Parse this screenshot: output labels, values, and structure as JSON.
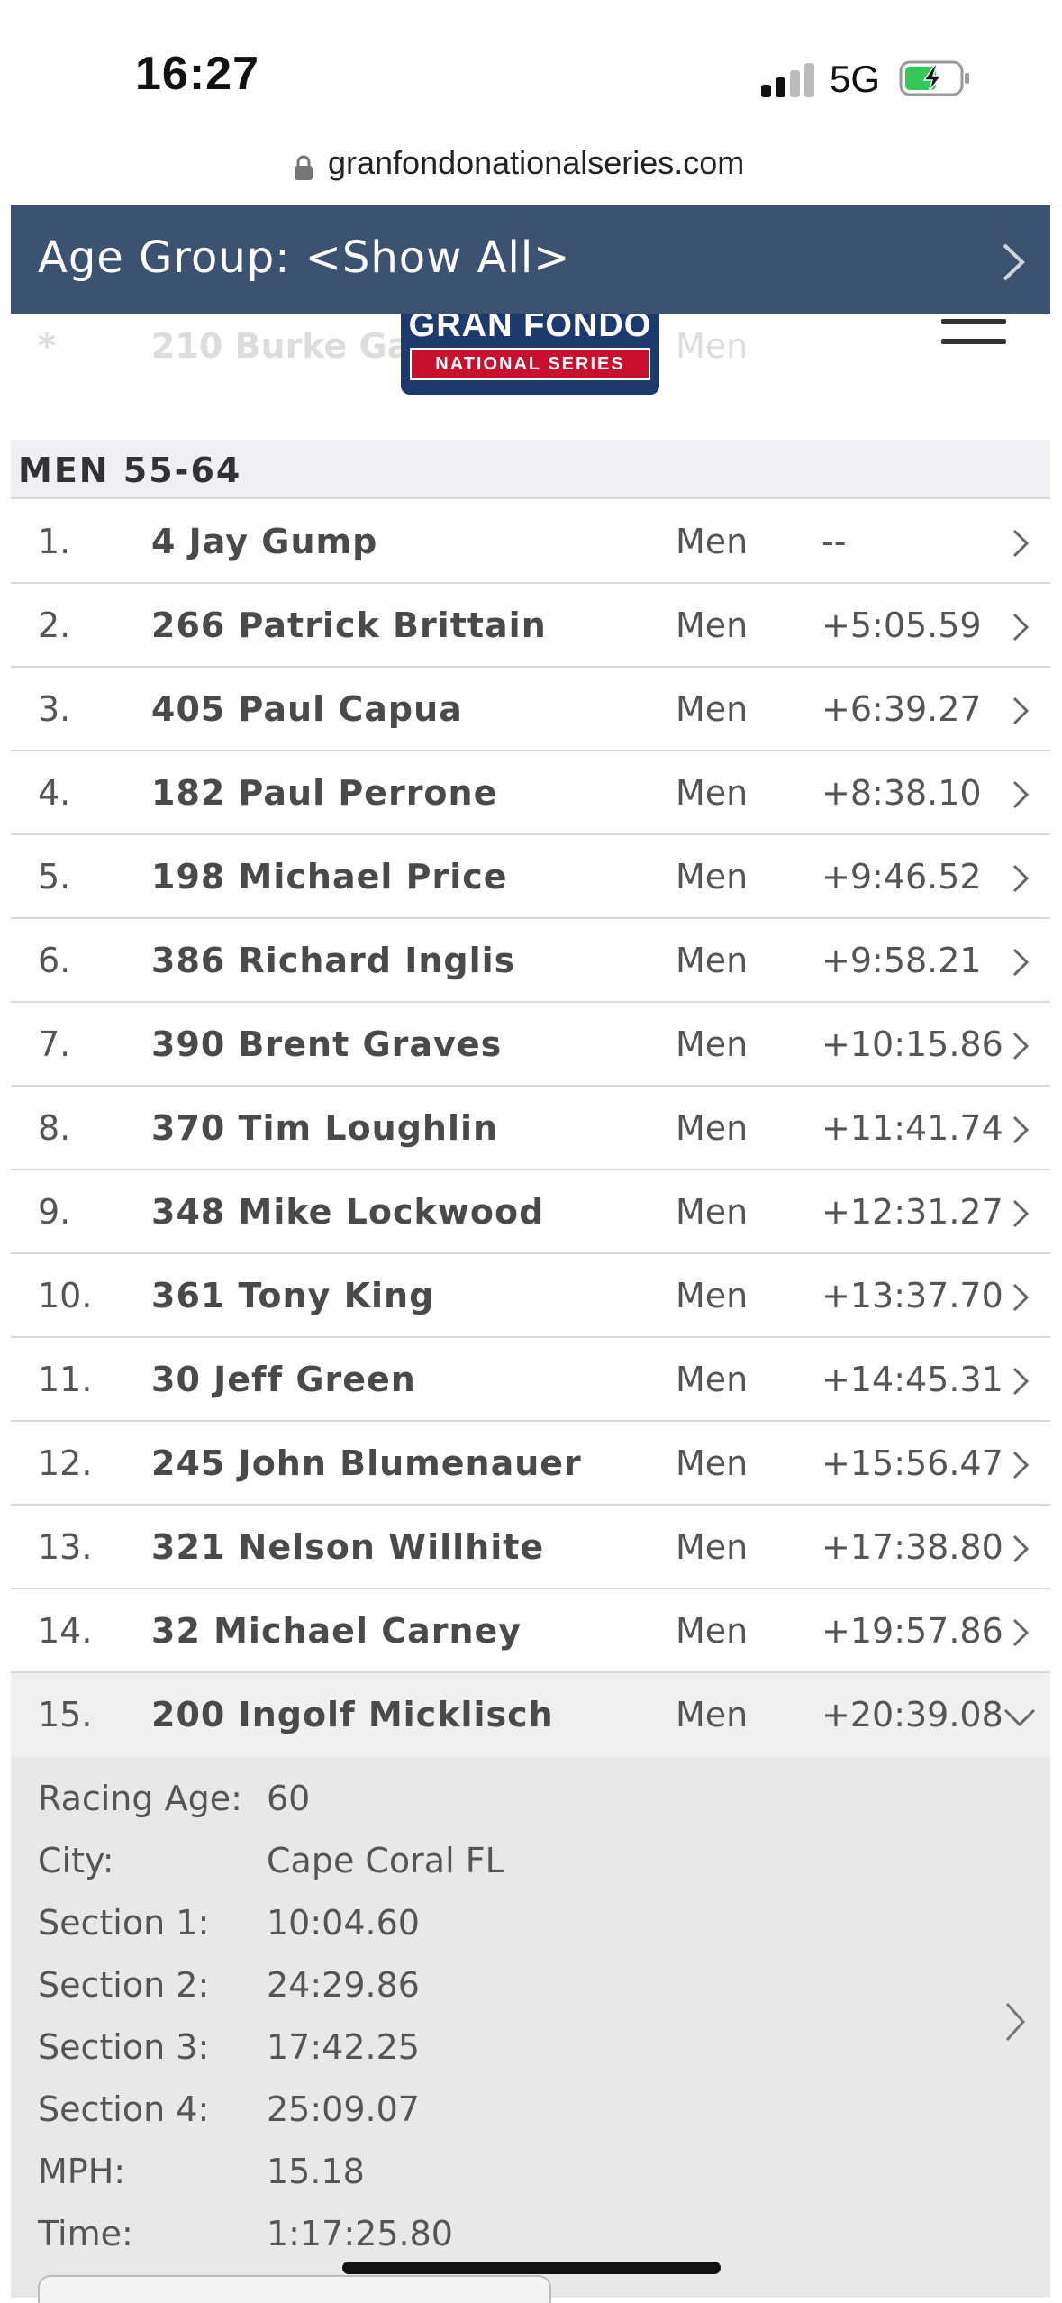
{
  "status_bar": {
    "time": "16:27",
    "network": "5G",
    "signal_icon": "cellular-signal-icon",
    "battery_icon": "battery-charging-icon"
  },
  "browser": {
    "url": "granfondonationalseries.com",
    "lock_icon": "lock-icon"
  },
  "header": {
    "logo_top": "GRAN FONDO",
    "logo_bottom": "NATIONAL SERIES",
    "ghost_row": {
      "position": "*",
      "name": "210 Burke Ga",
      "category": "Men"
    },
    "menu_icon": "hamburger-menu-icon"
  },
  "age_group": {
    "label": "Age Group: <Show All>"
  },
  "section": {
    "title": "MEN 55-64"
  },
  "results": [
    {
      "position": "1.",
      "name": "4 Jay Gump",
      "category": "Men",
      "gap": "--"
    },
    {
      "position": "2.",
      "name": "266 Patrick Brittain",
      "category": "Men",
      "gap": "+5:05.59"
    },
    {
      "position": "3.",
      "name": "405 Paul Capua",
      "category": "Men",
      "gap": "+6:39.27"
    },
    {
      "position": "4.",
      "name": "182 Paul Perrone",
      "category": "Men",
      "gap": "+8:38.10"
    },
    {
      "position": "5.",
      "name": "198 Michael Price",
      "category": "Men",
      "gap": "+9:46.52"
    },
    {
      "position": "6.",
      "name": "386 Richard Inglis",
      "category": "Men",
      "gap": "+9:58.21"
    },
    {
      "position": "7.",
      "name": "390 Brent Graves",
      "category": "Men",
      "gap": "+10:15.86"
    },
    {
      "position": "8.",
      "name": "370 Tim Loughlin",
      "category": "Men",
      "gap": "+11:41.74"
    },
    {
      "position": "9.",
      "name": "348 Mike Lockwood",
      "category": "Men",
      "gap": "+12:31.27"
    },
    {
      "position": "10.",
      "name": "361 Tony King",
      "category": "Men",
      "gap": "+13:37.70"
    },
    {
      "position": "11.",
      "name": "30 Jeff Green",
      "category": "Men",
      "gap": "+14:45.31"
    },
    {
      "position": "12.",
      "name": "245 John Blumenauer",
      "category": "Men",
      "gap": "+15:56.47"
    },
    {
      "position": "13.",
      "name": "321 Nelson Willhite",
      "category": "Men",
      "gap": "+17:38.80"
    },
    {
      "position": "14.",
      "name": "32 Michael Carney",
      "category": "Men",
      "gap": "+19:57.86"
    }
  ],
  "expanded": {
    "position": "15.",
    "name": "200 Ingolf Micklisch",
    "category": "Men",
    "gap": "+20:39.08",
    "details": [
      {
        "label": "Racing Age:",
        "value": "60"
      },
      {
        "label": "City:",
        "value": "Cape Coral FL"
      },
      {
        "label": "Section 1:",
        "value": "10:04.60"
      },
      {
        "label": "Section 2:",
        "value": "24:29.86"
      },
      {
        "label": "Section 3:",
        "value": "17:42.25"
      },
      {
        "label": "Section 4:",
        "value": "25:09.07"
      },
      {
        "label": "MPH:",
        "value": "15.18"
      },
      {
        "label": "Time:",
        "value": "1:17:25.80"
      }
    ]
  },
  "colors": {
    "age_bar": "#3b5271",
    "logo_blue": "#1d3a6c",
    "logo_red": "#c8102e",
    "battery_green": "#34c759"
  }
}
